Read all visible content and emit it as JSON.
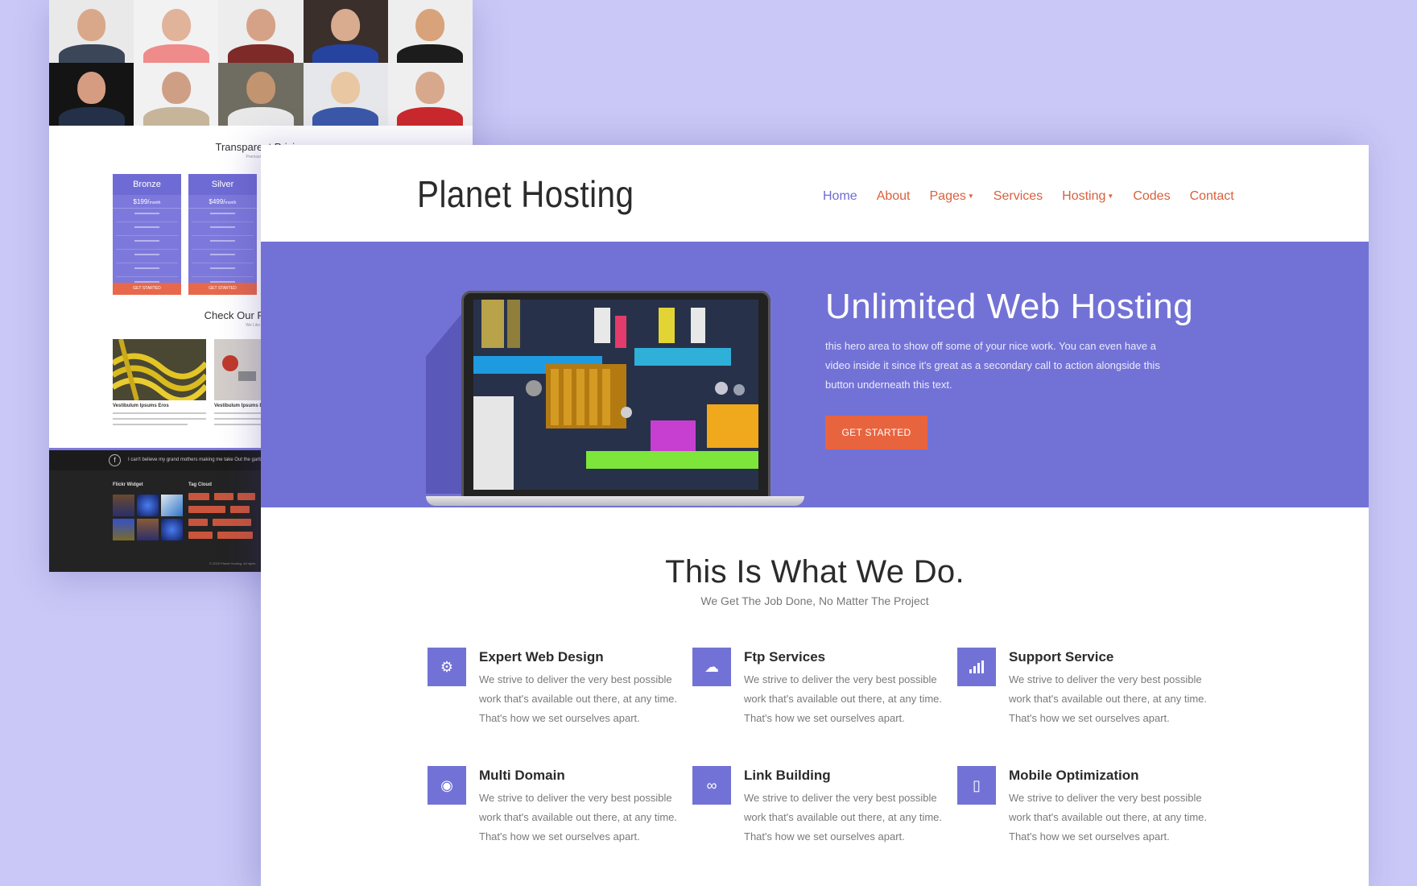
{
  "back_page": {
    "pricing_heading": "Transparent Pricing",
    "pricing_sub": "Premium Quality",
    "plans": [
      {
        "name": "Bronze",
        "price": "$199/",
        "period": "month",
        "button": "GET STARTED"
      },
      {
        "name": "Silver",
        "price": "$499/",
        "period": "month",
        "button": "GET STARTED"
      }
    ],
    "portfolio_heading": "Check Our Recent Work",
    "portfolio_sub": "We Like To Keep",
    "portfolio_items": [
      {
        "caption": "Vestibulum Ipsums Eros"
      },
      {
        "caption": "Vestibulum Ipsums Eros"
      }
    ],
    "footer": {
      "facebook_icon": "facebook-icon",
      "facebook_text": "I can't believe my grand mothers making me take Out the garb",
      "flickr_title": "Flickr Widget",
      "tag_title": "Tag Cloud",
      "copyright": "© 2015 Planet Hosting. All rights"
    }
  },
  "header": {
    "logo": "Planet Hosting",
    "nav": [
      {
        "label": "Home",
        "active": true
      },
      {
        "label": "About"
      },
      {
        "label": "Pages",
        "dropdown": true
      },
      {
        "label": "Services"
      },
      {
        "label": "Hosting",
        "dropdown": true
      },
      {
        "label": "Codes"
      },
      {
        "label": "Contact"
      }
    ]
  },
  "hero": {
    "title": "Unlimited Web Hosting",
    "text": "this hero area to show off some of your nice work. You can even have a video inside it since it's great as a secondary call to action alongside this button underneath this text.",
    "button": "GET STARTED"
  },
  "services": {
    "title": "This Is What We Do.",
    "subtitle": "We Get The Job Done, No Matter The Project",
    "items": [
      {
        "title": "Expert Web Design",
        "icon": "gear-icon",
        "glyph": "⚙",
        "desc": "We strive to deliver the very best possible work that's available out there, at any time. That's how we set ourselves apart."
      },
      {
        "title": "Ftp Services",
        "icon": "cloud-icon",
        "glyph": "☁",
        "desc": "We strive to deliver the very best possible work that's available out there, at any time. That's how we set ourselves apart."
      },
      {
        "title": "Support Service",
        "icon": "signal-icon",
        "glyph": "▮",
        "desc": "We strive to deliver the very best possible work that's available out there, at any time. That's how we set ourselves apart."
      },
      {
        "title": "Multi Domain",
        "icon": "globe-icon",
        "glyph": "◉",
        "desc": "We strive to deliver the very best possible work that's available out there, at any time. That's how we set ourselves apart."
      },
      {
        "title": "Link Building",
        "icon": "link-icon",
        "glyph": "∞",
        "desc": "We strive to deliver the very best possible work that's available out there, at any time. That's how we set ourselves apart."
      },
      {
        "title": "Mobile Optimization",
        "icon": "mobile-icon",
        "glyph": "▯",
        "desc": "We strive to deliver the very best possible work that's available out there, at any time. That's how we set ourselves apart."
      }
    ]
  },
  "colors": {
    "accent": "#7272d6",
    "cta": "#e8643f",
    "background": "#c9c8f6"
  }
}
